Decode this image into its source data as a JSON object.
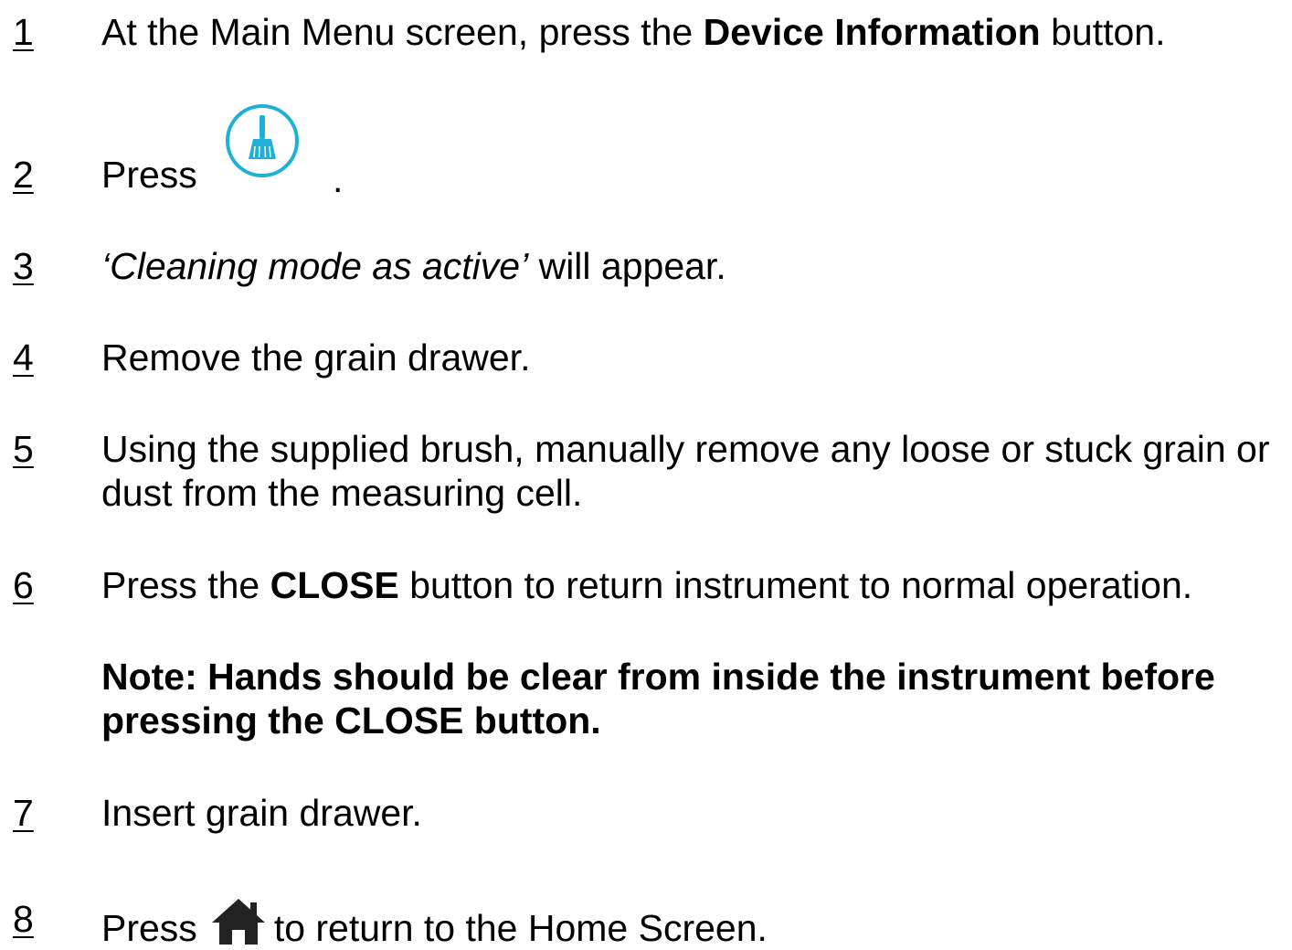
{
  "steps": [
    {
      "number": "1",
      "text_before": "At the Main Menu screen, press the ",
      "bold": "Device Information",
      "text_after": " button."
    },
    {
      "number": "2",
      "text": "Press",
      "trailing": "."
    },
    {
      "number": "3",
      "italic": "‘Cleaning mode as active’",
      "text_after": " will appear."
    },
    {
      "number": "4",
      "text": "Remove the grain drawer."
    },
    {
      "number": "5",
      "text": "Using the supplied brush, manually remove any loose or stuck grain or dust from the measuring cell."
    },
    {
      "number": "6",
      "text_before": "Press the ",
      "bold": "CLOSE",
      "text_after": " button to return instrument to normal operation."
    },
    {
      "number": "7",
      "text": "Insert grain drawer."
    },
    {
      "number": "8",
      "text_before": "Press",
      "text_after": "to return to the Home Screen."
    }
  ],
  "note": "Note:  Hands should be clear from inside the instrument before pressing the CLOSE button.",
  "icons": {
    "cleaning": "brush-icon",
    "home": "home-icon",
    "accent_color": "#1fb0d8",
    "home_color": "#222222"
  }
}
